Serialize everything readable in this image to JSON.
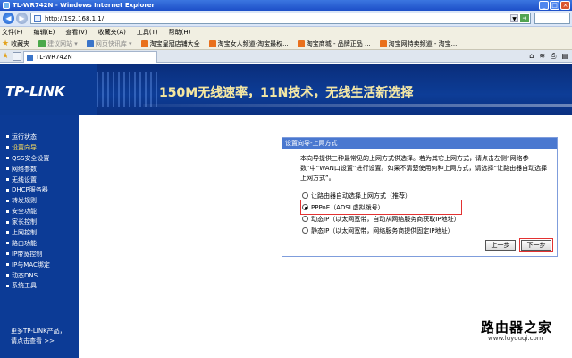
{
  "window": {
    "title": "TL-WR742N - Windows Internet Explorer"
  },
  "address_bar": {
    "url": "http://192.168.1.1/"
  },
  "menu": [
    "文件(F)",
    "编辑(E)",
    "查看(V)",
    "收藏夹(A)",
    "工具(T)",
    "帮助(H)"
  ],
  "favorites": [
    {
      "label": "收藏夹",
      "icon": "star-icon",
      "muted": false
    },
    {
      "label": "建议网站 ▾",
      "icon": "green-leaf-icon",
      "muted": true
    },
    {
      "label": "网页快讯库 ▾",
      "icon": "feed-icon",
      "muted": true
    },
    {
      "label": "淘宝皇冠店铺大全",
      "icon": "taobao-icon",
      "muted": false
    },
    {
      "label": "淘宝女人频道-淘宝最权...",
      "icon": "taobao-icon",
      "muted": false
    },
    {
      "label": "淘宝商城 - 品牌正品 ...",
      "icon": "taobao-icon",
      "muted": false
    },
    {
      "label": "淘宝网特卖频道 - 淘宝...",
      "icon": "taobao-icon",
      "muted": false
    }
  ],
  "tab": {
    "label": "TL-WR742N"
  },
  "banner": {
    "logo": "TP-LINK",
    "slogan": "150M无线速率，11N技术，无线生活新选择"
  },
  "sidebar": {
    "items": [
      "运行状态",
      "设置向导",
      "QSS安全设置",
      "网络参数",
      "无线设置",
      "DHCP服务器",
      "转发规则",
      "安全功能",
      "家长控制",
      "上网控制",
      "路由功能",
      "IP带宽控制",
      "IP与MAC绑定",
      "动态DNS",
      "系统工具"
    ],
    "active_index": 1,
    "more_line1": "更多TP-LINK产品，",
    "more_line2": "请点击查看 >>"
  },
  "panel": {
    "title": "设置向导-上网方式",
    "description": "本向导提供三种最常见的上网方式供选择。若为其它上网方式，请点击左侧“网络参数”中“WAN口设置”进行设置。如果不清楚使用何种上网方式，请选择“让路由器自动选择上网方式”。",
    "options": [
      {
        "label": "让路由器自动选择上网方式（推荐）",
        "checked": false
      },
      {
        "label": "PPPoE（ADSL虚拟拨号）",
        "checked": true
      },
      {
        "label": "动态IP（以太网宽带，自动从网络服务商获取IP地址）",
        "checked": false
      },
      {
        "label": "静态IP（以太网宽带，网络服务商提供固定IP地址）",
        "checked": false
      }
    ],
    "prev_label": "上一步",
    "next_label": "下一步"
  },
  "watermark": {
    "text": "路由器之家",
    "sub": "www.luyouqi.com"
  }
}
